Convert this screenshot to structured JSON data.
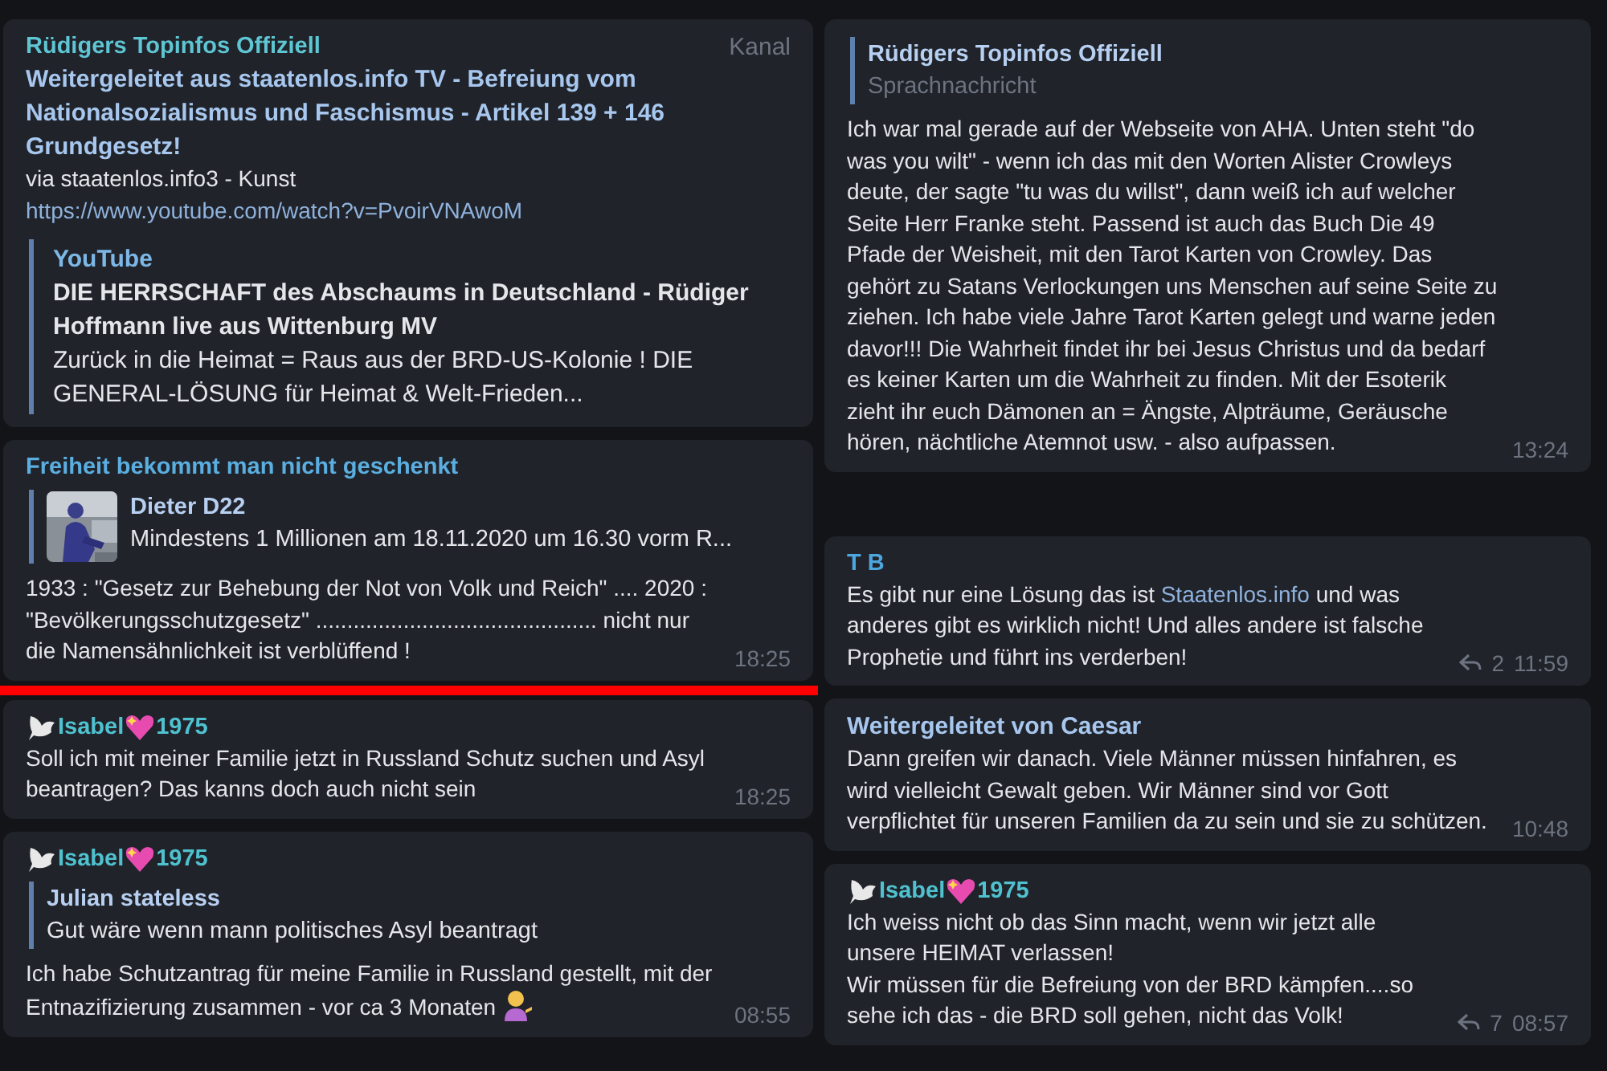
{
  "columns": [
    {
      "items": [
        {
          "kind": "message",
          "author": [
            {
              "kind": "text",
              "text": "Rüdigers Topinfos Offiziell"
            }
          ],
          "color": "#5ec6d3",
          "badge": "Kanal",
          "forward_title": "Weitergeleitet aus staatenlos.info TV - Befreiung vom Nationalsozialismus und Faschismus - Artikel 139 + 146 Grundgesetz!",
          "text": [
            {
              "kind": "text",
              "text": "via staatenlos.info3 - Kunst "
            },
            {
              "kind": "link",
              "text": "https://www.youtube.com/watch?v=PvoirVNAwoM"
            }
          ],
          "preview": {
            "site": "YouTube",
            "title": "DIE HERRSCHAFT des Abschaums in Deutschland - Rüdiger Hoffmann live aus Wittenburg MV",
            "description": "Zurück in die Heimat = Raus aus der BRD-US-Kolonie ! DIE GENERAL-LÖSUNG für Heimat & Welt-Frieden..."
          }
        },
        {
          "kind": "message",
          "author": [
            {
              "kind": "text",
              "text": "Freiheit bekommt man nicht geschenkt"
            }
          ],
          "color": "#5aaee0",
          "reply": {
            "author": "Dieter D22",
            "text": "Mindestens  1 Millionen am 18.11.2020 um 16.30 vorm R...",
            "is_media": false
          },
          "text": [
            {
              "kind": "text",
              "text": "1933 : \"Gesetz zur Behebung der Not von Volk und Reich\" .... 2020 : \"Bevölkerungsschutzgesetz\" ............................................. nicht nur die Namensähnlichkeit ist verblüffend !"
            }
          ],
          "time": "18:25"
        },
        {
          "kind": "red_line"
        },
        {
          "kind": "message",
          "author": [
            {
              "kind": "dove"
            },
            {
              "kind": "text",
              "text": "Isabel"
            },
            {
              "kind": "heart"
            },
            {
              "kind": "text",
              "text": "1975"
            }
          ],
          "color": "#4fc1cf",
          "text": [
            {
              "kind": "text",
              "text": "Soll ich mit meiner Familie jetzt in Russland Schutz suchen und Asyl beantragen? Das kanns doch auch nicht sein"
            }
          ],
          "time": "18:25"
        },
        {
          "kind": "message",
          "author": [
            {
              "kind": "dove"
            },
            {
              "kind": "text",
              "text": "Isabel"
            },
            {
              "kind": "heart"
            },
            {
              "kind": "text",
              "text": "1975"
            }
          ],
          "color": "#4fc1cf",
          "reply": {
            "author": "Julian stateless",
            "text": "Gut wäre wenn mann politisches Asyl beantragt",
            "is_media": false
          },
          "text": [
            {
              "kind": "text",
              "text": "Ich habe Schutzantrag für meine Familie in Russland gestellt, mit der Entnazifizierung zusammen - vor ca 3 Monaten "
            },
            {
              "kind": "person"
            }
          ],
          "time": "08:55"
        }
      ]
    },
    {
      "items": [
        {
          "kind": "message",
          "reply": {
            "author": "Rüdigers Topinfos Offiziell",
            "text": "Sprachnachricht",
            "is_media": true
          },
          "text": [
            {
              "kind": "text",
              "text": "Ich war mal gerade auf der Webseite von AHA. Unten steht \"do was you wilt\" - wenn ich das mit den Worten Alister Crowleys deute, der sagte \"tu was du willst\", dann weiß ich auf welcher Seite Herr Franke steht. Passend ist auch das Buch Die 49 Pfade der Weisheit, mit den Tarot Karten von Crowley. Das gehört zu Satans Verlockungen uns Menschen auf seine Seite zu ziehen. Ich habe viele Jahre Tarot Karten gelegt und warne jeden davor!!! Die Wahrheit findet ihr bei Jesus Christus und da bedarf es keiner Karten um die Wahrheit zu finden. Mit der Esoterik zieht ihr euch Dämonen an = Ängste, Alpträume, Geräusche hören, nächtliche Atemnot usw. - also aufpassen."
            }
          ],
          "time": "13:24"
        },
        {
          "kind": "gap"
        },
        {
          "kind": "message",
          "author": [
            {
              "kind": "text",
              "text": "T B"
            }
          ],
          "color": "#4ea6df",
          "text": [
            {
              "kind": "text",
              "text": "Es gibt nur eine Lösung das ist "
            },
            {
              "kind": "link",
              "text": "Staatenlos.info"
            },
            {
              "kind": "text",
              "text": " und was anderes gibt es wirklich nicht! Und alles andere ist falsche Prophetie und führt ins verderben!"
            }
          ],
          "replies": "2",
          "time": "11:59"
        },
        {
          "kind": "message",
          "forward_title": "Weitergeleitet von Caesar",
          "text": [
            {
              "kind": "text",
              "text": "Dann greifen wir danach. Viele Männer müssen hinfahren, es wird vielleicht Gewalt geben. Wir Männer sind vor Gott verpflichtet für unseren Familien da zu sein und sie zu schützen."
            }
          ],
          "time": "10:48"
        },
        {
          "kind": "message",
          "author": [
            {
              "kind": "dove"
            },
            {
              "kind": "text",
              "text": "Isabel"
            },
            {
              "kind": "heart"
            },
            {
              "kind": "text",
              "text": "1975"
            }
          ],
          "color": "#4fc1cf",
          "text": [
            {
              "kind": "text",
              "text": "Ich weiss nicht ob das Sinn macht, wenn wir jetzt alle unsere HEIMAT verlassen!\nWir müssen für die Befreiung von der BRD kämpfen....so sehe ich das - die BRD soll gehen, nicht das Volk!"
            }
          ],
          "replies": "7",
          "time": "08:57"
        }
      ]
    }
  ]
}
